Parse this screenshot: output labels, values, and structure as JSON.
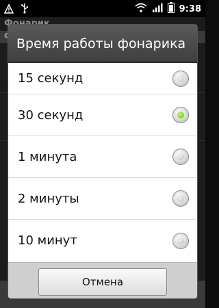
{
  "status_bar": {
    "time": "9:38",
    "icons": [
      "alert-icon",
      "usb-icon",
      "wifi-icon",
      "signal-icon",
      "battery-icon"
    ]
  },
  "background_app": {
    "title": "Фонарик",
    "items": [
      "Ф"
    ]
  },
  "dialog": {
    "title": "Время работы фонарика",
    "options": [
      {
        "label": "15 секунд",
        "selected": false
      },
      {
        "label": "30 секунд",
        "selected": true
      },
      {
        "label": "1 минута",
        "selected": false
      },
      {
        "label": "2 минуты",
        "selected": false
      },
      {
        "label": "10 минут",
        "selected": false
      }
    ],
    "cancel_label": "Отмена"
  }
}
